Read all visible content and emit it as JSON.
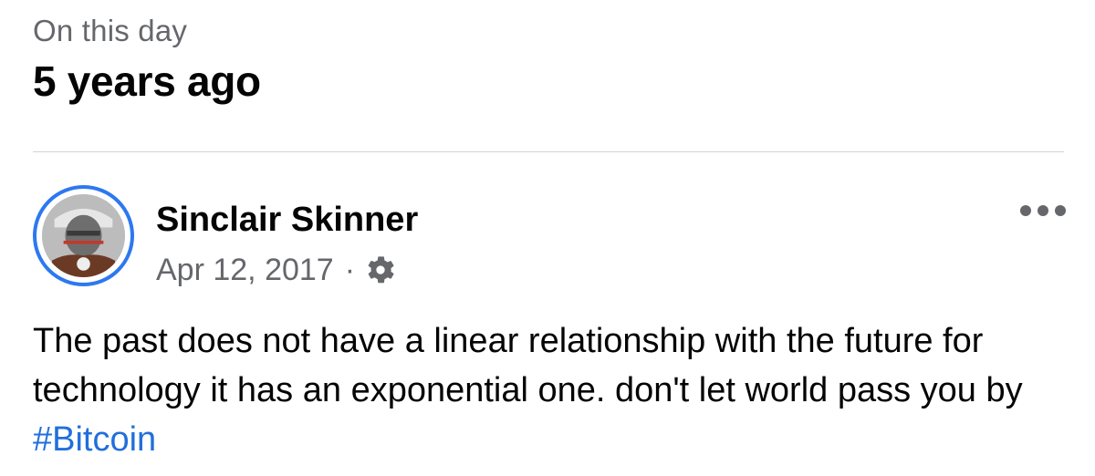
{
  "memory": {
    "label": "On this day",
    "title": "5 years ago"
  },
  "post": {
    "author": "Sinclair Skinner",
    "date": "Apr 12, 2017",
    "separator": "·",
    "privacy_icon": "gear-icon",
    "more_icon": "more-options-icon",
    "body_text": "The past does not have a linear relationship with the future for technology it has an exponential one. don't let world pass you by ",
    "hashtag": "#Bitcoin"
  },
  "colors": {
    "avatar_ring": "#2d78f0",
    "hashtag": "#216fdb",
    "secondary_text": "#65676b"
  }
}
